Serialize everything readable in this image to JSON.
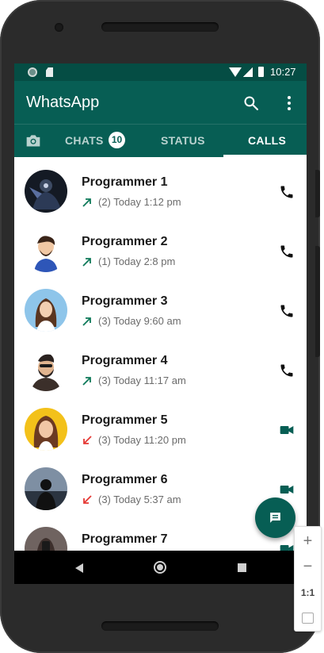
{
  "status_bar": {
    "time": "10:27"
  },
  "app": {
    "title": "WhatsApp"
  },
  "tabs": {
    "chats": {
      "label": "CHATS",
      "badge": "10"
    },
    "status": {
      "label": "STATUS"
    },
    "calls": {
      "label": "CALLS",
      "selected": true
    }
  },
  "calls": [
    {
      "name": "Programmer 1",
      "direction": "outgoing",
      "detail": "(2) Today 1:12 pm",
      "call_type": "voice"
    },
    {
      "name": "Programmer 2",
      "direction": "outgoing",
      "detail": "(1) Today 2:8 pm",
      "call_type": "voice"
    },
    {
      "name": "Programmer 3",
      "direction": "outgoing",
      "detail": "(3) Today 9:60 am",
      "call_type": "voice"
    },
    {
      "name": "Programmer 4",
      "direction": "outgoing",
      "detail": "(3) Today 11:17 am",
      "call_type": "voice"
    },
    {
      "name": "Programmer 5",
      "direction": "missed",
      "detail": "(3) Today 11:20 pm",
      "call_type": "video"
    },
    {
      "name": "Programmer 6",
      "direction": "missed",
      "detail": "(3) Today 5:37 am",
      "call_type": "video"
    },
    {
      "name": "Programmer 7",
      "direction": "outgoing",
      "detail": "",
      "call_type": "video"
    }
  ],
  "zoom": {
    "zoom_in": "+",
    "zoom_out": "−",
    "reset": "1:1"
  },
  "colors": {
    "primary": "#075e54",
    "status_bar": "#054d44",
    "outgoing_arrow": "#0f7a5a",
    "missed_arrow": "#e53935"
  },
  "icons": {
    "search": "search-icon",
    "more": "more-vert-icon",
    "camera": "camera-icon",
    "voice_call": "phone-icon",
    "video_call": "video-icon",
    "new_chat": "message-icon"
  }
}
